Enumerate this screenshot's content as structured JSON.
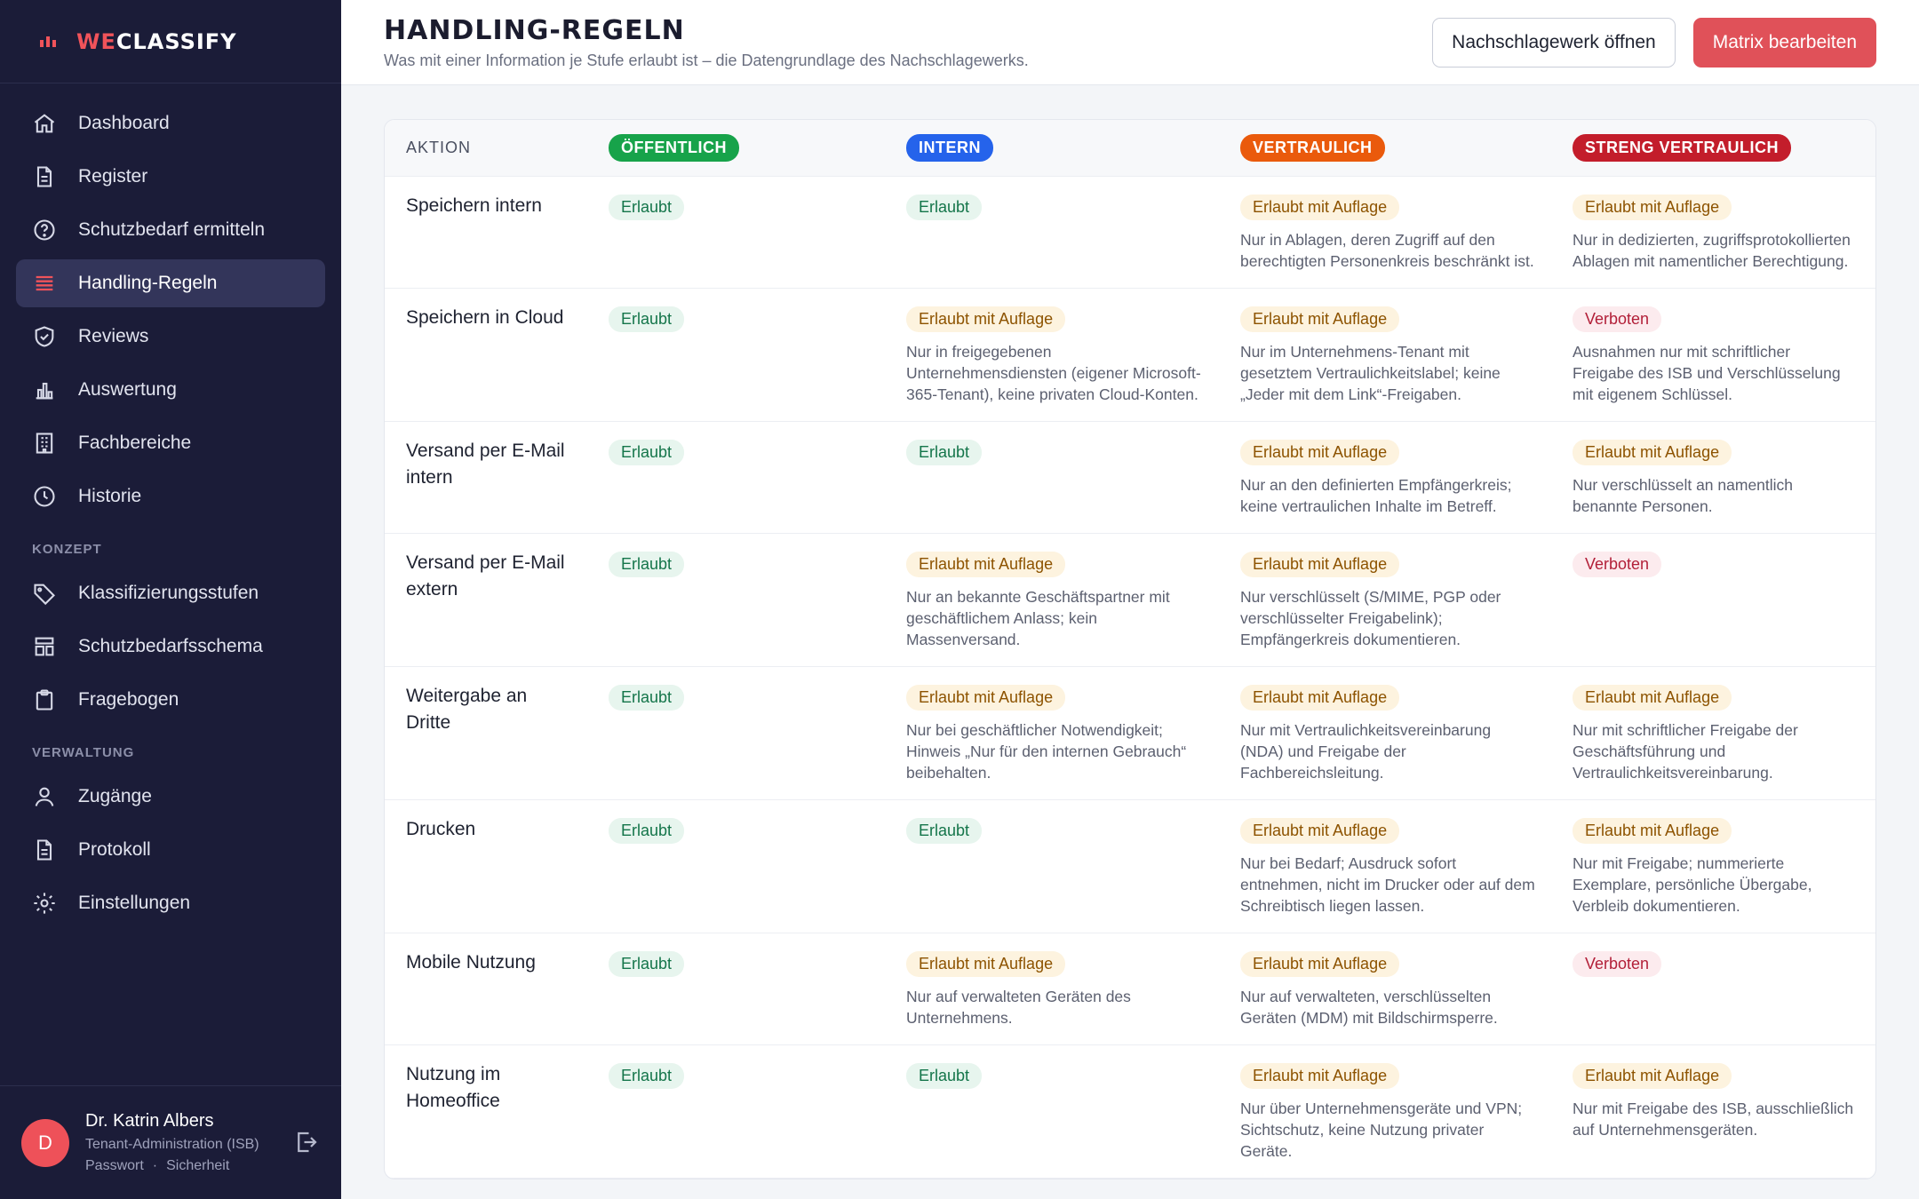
{
  "brand": {
    "part1": "WE",
    "part2": "CLASSIFY"
  },
  "sidebar": {
    "items": [
      {
        "label": "Dashboard"
      },
      {
        "label": "Register"
      },
      {
        "label": "Schutzbedarf ermitteln"
      },
      {
        "label": "Handling-Regeln"
      },
      {
        "label": "Reviews"
      },
      {
        "label": "Auswertung"
      },
      {
        "label": "Fachbereiche"
      },
      {
        "label": "Historie"
      }
    ],
    "section_konzept": "KONZEPT",
    "konzept_items": [
      {
        "label": "Klassifizierungsstufen"
      },
      {
        "label": "Schutzbedarfsschema"
      },
      {
        "label": "Fragebogen"
      }
    ],
    "section_verwaltung": "VERWALTUNG",
    "verwaltung_items": [
      {
        "label": "Zugänge"
      },
      {
        "label": "Protokoll"
      },
      {
        "label": "Einstellungen"
      }
    ]
  },
  "user": {
    "initial": "D",
    "name": "Dr. Katrin Albers",
    "role": "Tenant-Administration (ISB)",
    "link_password": "Passwort",
    "link_separator": "·",
    "link_security": "Sicherheit"
  },
  "header": {
    "title": "HANDLING-REGELN",
    "subtitle": "Was mit einer Information je Stufe erlaubt ist – die Datengrundlage des Nachschlagewerks.",
    "btn_open": "Nachschlagewerk öffnen",
    "btn_edit": "Matrix bearbeiten"
  },
  "colors": {
    "public": "#17a34a",
    "internal": "#2563eb",
    "confidential": "#ea5a0c",
    "strict": "#c31d2b",
    "accent": "#e05159"
  },
  "table": {
    "action_header": "AKTION",
    "levels": [
      "ÖFFENTLICH",
      "INTERN",
      "VERTRAULICH",
      "STRENG VERTRAULICH"
    ],
    "rows": [
      {
        "action": "Speichern intern",
        "c1": {
          "status": "Erlaubt",
          "note": ""
        },
        "c2": {
          "status": "Erlaubt",
          "note": ""
        },
        "c3": {
          "status": "Erlaubt mit Auflage",
          "note": "Nur in Ablagen, deren Zugriff auf den berechtigten Personenkreis beschränkt ist."
        },
        "c4": {
          "status": "Erlaubt mit Auflage",
          "note": "Nur in dedizierten, zugriffsprotokollierten Ablagen mit namentlicher Berechtigung."
        }
      },
      {
        "action": "Speichern in Cloud",
        "c1": {
          "status": "Erlaubt",
          "note": ""
        },
        "c2": {
          "status": "Erlaubt mit Auflage",
          "note": "Nur in freigegebenen Unternehmensdiensten (eigener Microsoft-365-Tenant), keine privaten Cloud-Konten."
        },
        "c3": {
          "status": "Erlaubt mit Auflage",
          "note": "Nur im Unternehmens-Tenant mit gesetztem Vertraulichkeitslabel; keine „Jeder mit dem Link“-Freigaben."
        },
        "c4": {
          "status": "Verboten",
          "note": "Ausnahmen nur mit schriftlicher Freigabe des ISB und Verschlüsselung mit eigenem Schlüssel."
        }
      },
      {
        "action": "Versand per E-Mail intern",
        "c1": {
          "status": "Erlaubt",
          "note": ""
        },
        "c2": {
          "status": "Erlaubt",
          "note": ""
        },
        "c3": {
          "status": "Erlaubt mit Auflage",
          "note": "Nur an den definierten Empfängerkreis; keine vertraulichen Inhalte im Betreff."
        },
        "c4": {
          "status": "Erlaubt mit Auflage",
          "note": "Nur verschlüsselt an namentlich benannte Personen."
        }
      },
      {
        "action": "Versand per E-Mail extern",
        "c1": {
          "status": "Erlaubt",
          "note": ""
        },
        "c2": {
          "status": "Erlaubt mit Auflage",
          "note": "Nur an bekannte Geschäftspartner mit geschäftlichem Anlass; kein Massenversand."
        },
        "c3": {
          "status": "Erlaubt mit Auflage",
          "note": "Nur verschlüsselt (S/MIME, PGP oder verschlüsselter Freigabelink); Empfängerkreis dokumentieren."
        },
        "c4": {
          "status": "Verboten",
          "note": ""
        }
      },
      {
        "action": "Weitergabe an Dritte",
        "c1": {
          "status": "Erlaubt",
          "note": ""
        },
        "c2": {
          "status": "Erlaubt mit Auflage",
          "note": "Nur bei geschäftlicher Notwendigkeit; Hinweis „Nur für den internen Gebrauch“ beibehalten."
        },
        "c3": {
          "status": "Erlaubt mit Auflage",
          "note": "Nur mit Vertraulichkeitsvereinbarung (NDA) und Freigabe der Fachbereichsleitung."
        },
        "c4": {
          "status": "Erlaubt mit Auflage",
          "note": "Nur mit schriftlicher Freigabe der Geschäftsführung und Vertraulichkeitsvereinbarung."
        }
      },
      {
        "action": "Drucken",
        "c1": {
          "status": "Erlaubt",
          "note": ""
        },
        "c2": {
          "status": "Erlaubt",
          "note": ""
        },
        "c3": {
          "status": "Erlaubt mit Auflage",
          "note": "Nur bei Bedarf; Ausdruck sofort entnehmen, nicht im Drucker oder auf dem Schreibtisch liegen lassen."
        },
        "c4": {
          "status": "Erlaubt mit Auflage",
          "note": "Nur mit Freigabe; nummerierte Exemplare, persönliche Übergabe, Verbleib dokumentieren."
        }
      },
      {
        "action": "Mobile Nutzung",
        "c1": {
          "status": "Erlaubt",
          "note": ""
        },
        "c2": {
          "status": "Erlaubt mit Auflage",
          "note": "Nur auf verwalteten Geräten des Unternehmens."
        },
        "c3": {
          "status": "Erlaubt mit Auflage",
          "note": "Nur auf verwalteten, verschlüsselten Geräten (MDM) mit Bildschirmsperre."
        },
        "c4": {
          "status": "Verboten",
          "note": ""
        }
      },
      {
        "action": "Nutzung im Homeoffice",
        "c1": {
          "status": "Erlaubt",
          "note": ""
        },
        "c2": {
          "status": "Erlaubt",
          "note": ""
        },
        "c3": {
          "status": "Erlaubt mit Auflage",
          "note": "Nur über Unternehmensgeräte und VPN; Sichtschutz, keine Nutzung privater Geräte."
        },
        "c4": {
          "status": "Erlaubt mit Auflage",
          "note": "Nur mit Freigabe des ISB, ausschließlich auf Unternehmensgeräten."
        }
      }
    ]
  }
}
